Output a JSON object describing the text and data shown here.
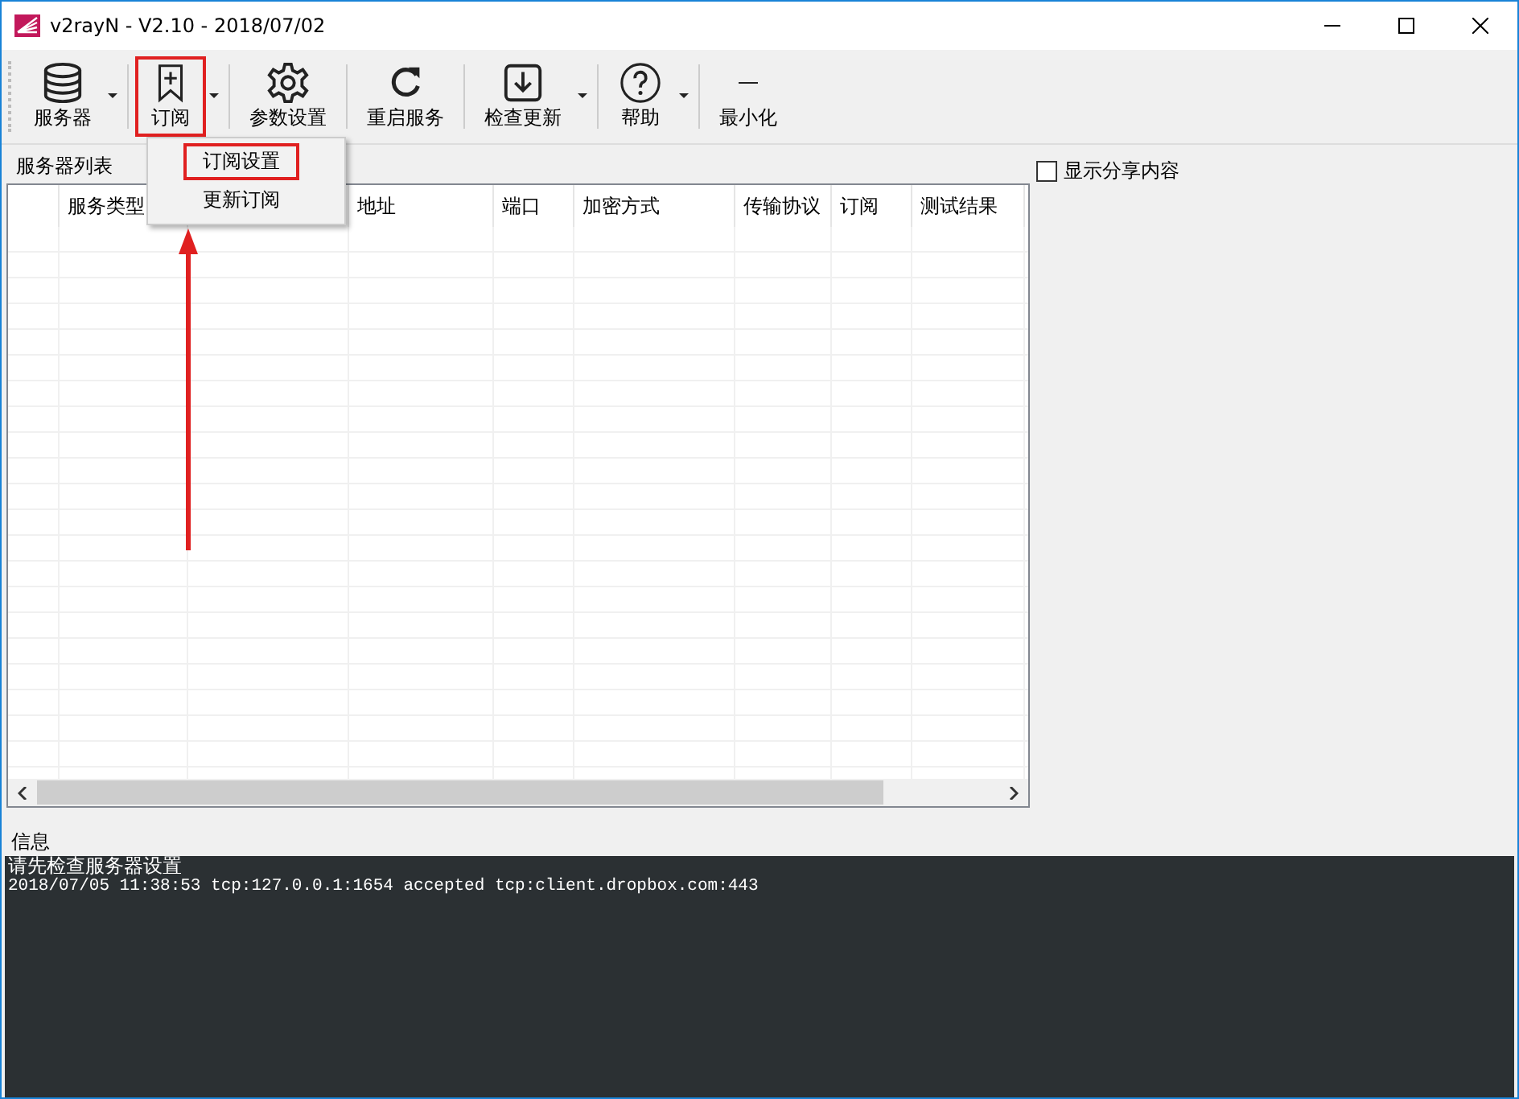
{
  "window": {
    "title": "v2rayN - V2.10 - 2018/07/02"
  },
  "toolbar": [
    {
      "label": "服务器",
      "kind": "database",
      "dropdown": true,
      "highlighted": false
    },
    {
      "label": "订阅",
      "kind": "bookmark",
      "dropdown": true,
      "highlighted": true
    },
    {
      "label": "参数设置",
      "kind": "gear",
      "dropdown": false,
      "highlighted": false
    },
    {
      "label": "重启服务",
      "kind": "reload",
      "dropdown": false,
      "highlighted": false
    },
    {
      "label": "检查更新",
      "kind": "download",
      "dropdown": true,
      "highlighted": false
    },
    {
      "label": "帮助",
      "kind": "help",
      "dropdown": true,
      "highlighted": false
    },
    {
      "label": "最小化",
      "kind": "minimize",
      "dropdown": false,
      "highlighted": false
    }
  ],
  "menu": [
    {
      "label": "订阅设置",
      "highlighted": true
    },
    {
      "label": "更新订阅",
      "highlighted": false
    }
  ],
  "server_list": {
    "title": "服务器列表",
    "columns": [
      "",
      "服务类型",
      "",
      "地址",
      "端口",
      "加密方式",
      "传输协议",
      "订阅",
      "测试结果"
    ]
  },
  "share_checkbox": {
    "label": "显示分享内容",
    "checked": false
  },
  "info": {
    "title": "信息",
    "lines": [
      "请先检查服务器设置",
      "2018/07/05 11:38:53 tcp:127.0.0.1:1654 accepted tcp:client.dropbox.com:443"
    ]
  }
}
